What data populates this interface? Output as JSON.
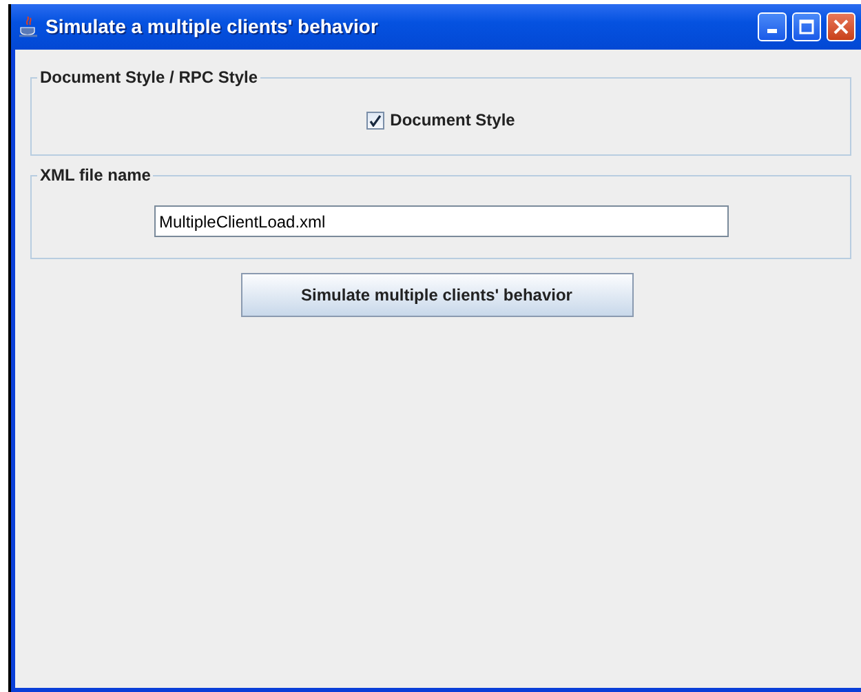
{
  "window": {
    "title": "Simulate a multiple clients' behavior"
  },
  "style_group": {
    "legend": "Document Style / RPC Style",
    "checkbox": {
      "label": "Document Style",
      "checked": true
    }
  },
  "file_group": {
    "legend": "XML file name",
    "value": "MultipleClientLoad.xml"
  },
  "buttons": [
    "Simulate multiple clients' behavior"
  ]
}
